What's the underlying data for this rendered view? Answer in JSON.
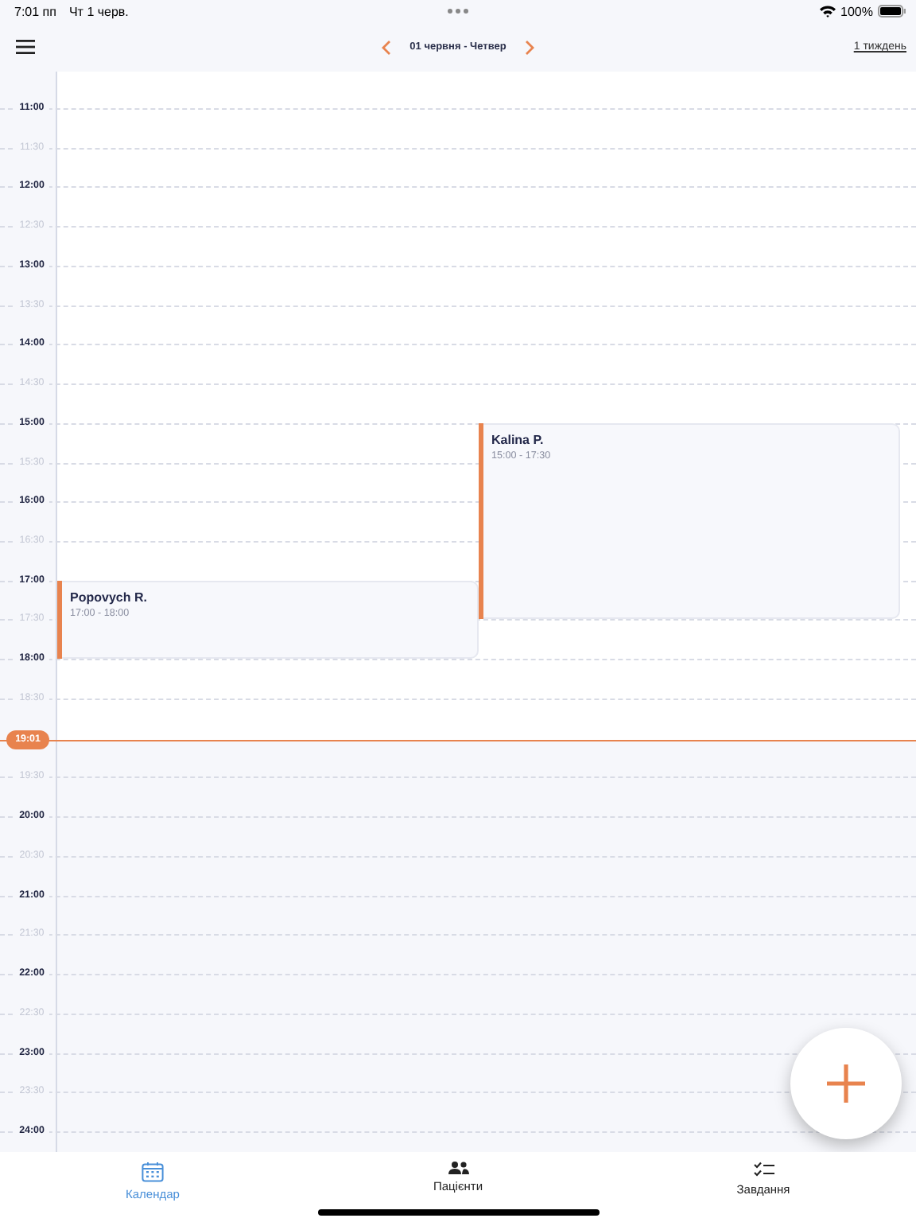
{
  "status_bar": {
    "time": "7:01 пп",
    "date": "Чт 1 черв.",
    "battery": "100%"
  },
  "header": {
    "date_title": "01 червня - Четвер",
    "view_link": "1 тиждень"
  },
  "timeline": {
    "hours": [
      {
        "label": "11:00",
        "kind": "hour"
      },
      {
        "label": "11:30",
        "kind": "half"
      },
      {
        "label": "12:00",
        "kind": "hour"
      },
      {
        "label": "12:30",
        "kind": "half"
      },
      {
        "label": "13:00",
        "kind": "hour"
      },
      {
        "label": "13:30",
        "kind": "half"
      },
      {
        "label": "14:00",
        "kind": "hour"
      },
      {
        "label": "14:30",
        "kind": "half"
      },
      {
        "label": "15:00",
        "kind": "hour"
      },
      {
        "label": "15:30",
        "kind": "half"
      },
      {
        "label": "16:00",
        "kind": "hour"
      },
      {
        "label": "16:30",
        "kind": "half"
      },
      {
        "label": "17:00",
        "kind": "hour"
      },
      {
        "label": "17:30",
        "kind": "half"
      },
      {
        "label": "18:00",
        "kind": "hour"
      },
      {
        "label": "18:30",
        "kind": "half"
      },
      {
        "label": "19:30",
        "kind": "half"
      },
      {
        "label": "20:00",
        "kind": "hour"
      },
      {
        "label": "20:30",
        "kind": "half"
      },
      {
        "label": "21:00",
        "kind": "hour"
      },
      {
        "label": "21:30",
        "kind": "half"
      },
      {
        "label": "22:00",
        "kind": "hour"
      },
      {
        "label": "22:30",
        "kind": "half"
      },
      {
        "label": "23:00",
        "kind": "hour"
      },
      {
        "label": "23:30",
        "kind": "half"
      },
      {
        "label": "24:00",
        "kind": "hour"
      }
    ],
    "events": [
      {
        "name": "Popovych R.",
        "time": "17:00 - 18:00"
      },
      {
        "name": "Kalina P.",
        "time": "15:00 - 17:30"
      }
    ],
    "now": "19:01"
  },
  "tabs": [
    {
      "label": "Календар",
      "kind": "calendar",
      "selected": true
    },
    {
      "label": "Пацієнти",
      "kind": "people",
      "selected": false
    },
    {
      "label": "Завдання",
      "kind": "tasks",
      "selected": false
    }
  ]
}
